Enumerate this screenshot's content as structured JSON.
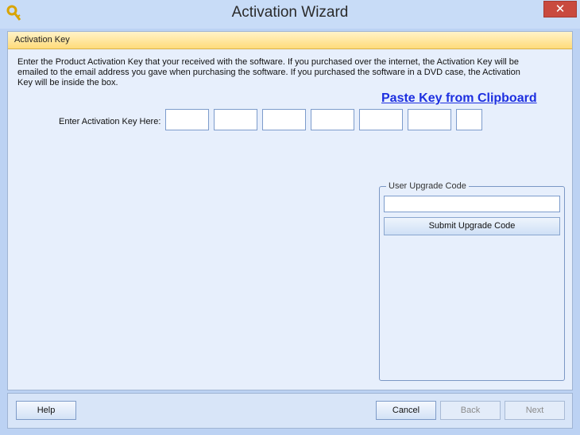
{
  "window": {
    "title": "Activation Wizard",
    "close_label": "✕"
  },
  "panel": {
    "header": "Activation Key",
    "instructions": "Enter the Product Activation Key that your received with the software. If you purchased over the internet, the Activation Key will be emailed to the email address you gave when purchasing the software. If you purchased the software in a DVD case, the Activation Key will be inside the box.",
    "paste_link": "Paste Key from Clipboard",
    "key_label": "Enter Activation Key Here:",
    "key_boxes": [
      "",
      "",
      "",
      "",
      "",
      "",
      ""
    ]
  },
  "upgrade": {
    "legend": "User Upgrade Code",
    "input_value": "",
    "submit_label": "Submit Upgrade Code"
  },
  "footer": {
    "help_label": "Help",
    "cancel_label": "Cancel",
    "back_label": "Back",
    "next_label": "Next"
  }
}
